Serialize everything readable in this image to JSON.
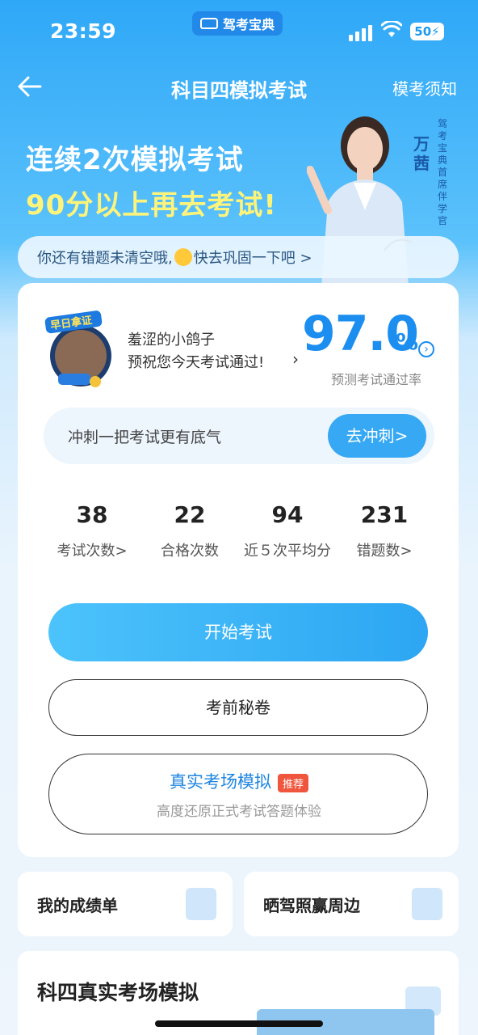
{
  "status_bar": {
    "time": "23:59",
    "app_label": "驾考宝典",
    "battery": "50"
  },
  "nav": {
    "title": "科目四模拟考试",
    "right_link": "模考须知"
  },
  "banner": {
    "line1": "连续2次模拟考试",
    "line2": "90分以上再去考试!",
    "person_name": "万茜",
    "person_title": "驾考宝典首席伴学官"
  },
  "tip": {
    "before": "你还有错题未清空哦,",
    "after": "快去巩固一下吧 >"
  },
  "card": {
    "badge_text": "早日拿证",
    "user_name": "羞涩的小鸽子",
    "blessing": "预祝您今天考试通过!",
    "pass_rate": "97.0",
    "pass_rate_unit": "%",
    "pass_rate_label": "预测考试通过率",
    "sprint_text": "冲刺一把考试更有底气",
    "sprint_button": "去冲刺>",
    "stats": [
      {
        "value": "38",
        "label": "考试次数>"
      },
      {
        "value": "22",
        "label": "合格次数"
      },
      {
        "value": "94",
        "label": "近５次平均分"
      },
      {
        "value": "231",
        "label": "错题数>"
      }
    ],
    "start_button": "开始考试",
    "secret_button": "考前秘卷",
    "real_sim_title": "真实考场模拟",
    "real_sim_tag": "推荐",
    "real_sim_subtitle": "高度还原正式考试答题体验"
  },
  "tiles": {
    "report": "我的成绩单",
    "share": "晒驾照赢周边"
  },
  "section": {
    "title": "科四真实考场模拟"
  },
  "colors": {
    "primary": "#1b8ef0",
    "button": "#36a8f4",
    "tag": "#f0563e",
    "slogan_yellow": "#fff47a"
  }
}
